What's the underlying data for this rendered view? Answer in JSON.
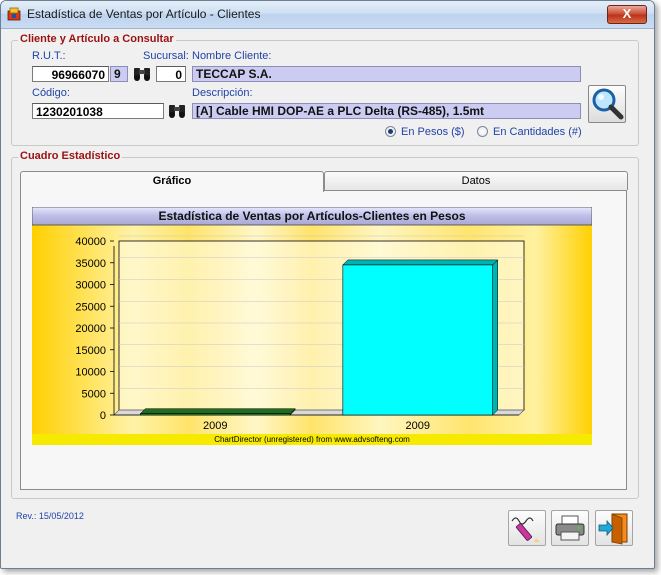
{
  "window": {
    "title": "Estadística de Ventas por Artículo - Clientes",
    "close_label": "X"
  },
  "consulta": {
    "group_title": "Cliente y Artículo a Consultar",
    "rut_label": "R.U.T.:",
    "rut_value": "96966070",
    "rut_dv": "9",
    "sucursal_label": "Sucursal:",
    "sucursal_value": "0",
    "nombre_label": "Nombre Cliente:",
    "nombre_value": "TECCAP S.A.",
    "codigo_label": "Código:",
    "codigo_value": "1230201038",
    "descripcion_label": "Descripción:",
    "descripcion_value": "[A] Cable HMI DOP-AE a PLC Delta (RS-485), 1.5mt",
    "radio_pesos_label": "En Pesos ($)",
    "radio_cantidades_label": "En Cantidades (#)",
    "radio_selected": "pesos"
  },
  "cuadro": {
    "group_title": "Cuadro Estadístico",
    "tab_grafico": "Gráfico",
    "tab_datos": "Datos"
  },
  "chart_data": {
    "type": "bar",
    "title": "Estadística de Ventas por Artículos-Clientes en Pesos",
    "categories": [
      "2009",
      "2009"
    ],
    "values": [
      300,
      34500
    ],
    "colors": [
      "#2e9a2e",
      "#00ffff"
    ],
    "ylim": [
      0,
      40000
    ],
    "yticks": [
      0,
      5000,
      10000,
      15000,
      20000,
      25000,
      30000,
      35000,
      40000
    ],
    "grid": true,
    "footer": "ChartDirector (unregistered) from www.advsofteng.com"
  },
  "footer": {
    "rev": "Rev.: 15/05/2012"
  }
}
